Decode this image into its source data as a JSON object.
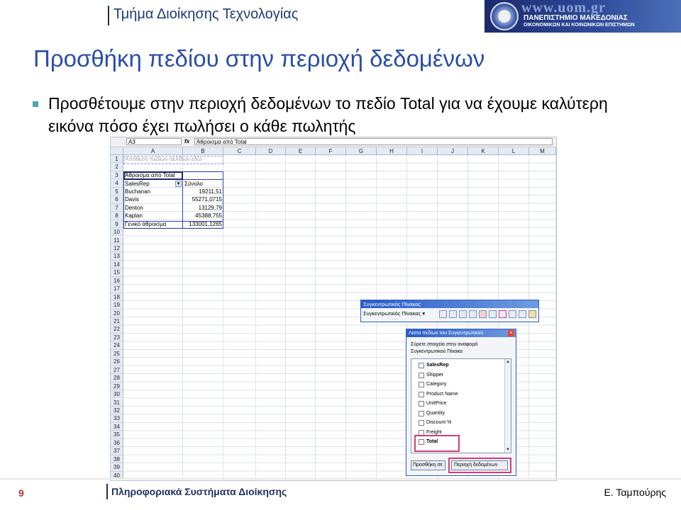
{
  "header": {
    "department": "Τμήμα Διοίκησης Τεχνολογίας"
  },
  "logo": {
    "url_text": "www.uom.gr",
    "line1": "ΠΑΝΕΠΙΣΤΗΜΙΟ ΜΑΚΕΔΟΝΙΑΣ",
    "line2": "ΟΙΚΟΝΟΜΙΚΩΝ ΚΑΙ ΚΟΙΝΩΝΙΚΩΝ ΕΠΙΣΤΗΜΩΝ"
  },
  "slide": {
    "title": "Προσθήκη πεδίου στην περιοχή δεδομένων",
    "bullet": "Προσθέτουμε στην περιοχή δεδομένων το πεδίο Total για να έχουμε καλύτερη εικόνα πόσο έχει πωλήσει ο κάθε πωλητής"
  },
  "excel": {
    "name_box": "A3",
    "fx": "fx",
    "formula": "Άθροισμα από Total",
    "columns": [
      "A",
      "B",
      "C",
      "D",
      "E",
      "F",
      "G",
      "H",
      "I",
      "J",
      "K",
      "L",
      "M"
    ],
    "rows": [
      "1",
      "2",
      "3",
      "4",
      "5",
      "6",
      "7",
      "8",
      "9",
      "10",
      "11",
      "12",
      "13",
      "14",
      "15",
      "16",
      "17",
      "18",
      "19",
      "20",
      "21",
      "22",
      "23",
      "24",
      "25",
      "26",
      "27",
      "28",
      "29",
      "30",
      "31",
      "32",
      "33",
      "34",
      "35",
      "36",
      "37",
      "38",
      "39",
      "40"
    ],
    "page_field_drop": "Απόθεση πεδίων σελίδων εδώ",
    "pivot_title": "Άθροισμα από Total",
    "row_field": "SalesRep",
    "total_header": "Σύνολο",
    "data": [
      {
        "rep": "Buchanan",
        "value": "19211,51"
      },
      {
        "rep": "Davis",
        "value": "55271,0715"
      },
      {
        "rep": "Denton",
        "value": "13129,79"
      },
      {
        "rep": "Kaplan",
        "value": "45388,755"
      }
    ],
    "grand_total_label": "Γενικό άθροισμα",
    "grand_total_value": "133001,1265"
  },
  "pivot_toolbar": {
    "title": "Συγκεντρωτικός Πίνακας",
    "menu": "Συγκεντρωτικός Πίνακας ▾"
  },
  "field_list": {
    "title": "Λίστα πεδίων του Συγκεντρωτικού",
    "close": "×",
    "instructions": "Σύρετε στοιχεία στην αναφορά Συγκεντρωτικού Πίνακα",
    "fields": [
      {
        "name": "SalesRep",
        "bold": true
      },
      {
        "name": "Shipper",
        "bold": false
      },
      {
        "name": "Category",
        "bold": false
      },
      {
        "name": "Product Name",
        "bold": false
      },
      {
        "name": "UnitPrice",
        "bold": false
      },
      {
        "name": "Quantity",
        "bold": false
      },
      {
        "name": "Discount %",
        "bold": false
      },
      {
        "name": "Freight",
        "bold": false
      },
      {
        "name": "Total",
        "bold": true
      }
    ],
    "add_button": "Προσθήκη σε",
    "area_select": "Περιοχή δεδομένων"
  },
  "footer": {
    "page": "9",
    "course": "Πληροφοριακά Συστήματα Διοίκησης",
    "author": "Ε. Ταμπούρης"
  },
  "colors": {
    "title": "#2a4ea8",
    "bullet": "#4ba8a8",
    "page_number": "#c0303a",
    "highlight": "#d23c78"
  }
}
